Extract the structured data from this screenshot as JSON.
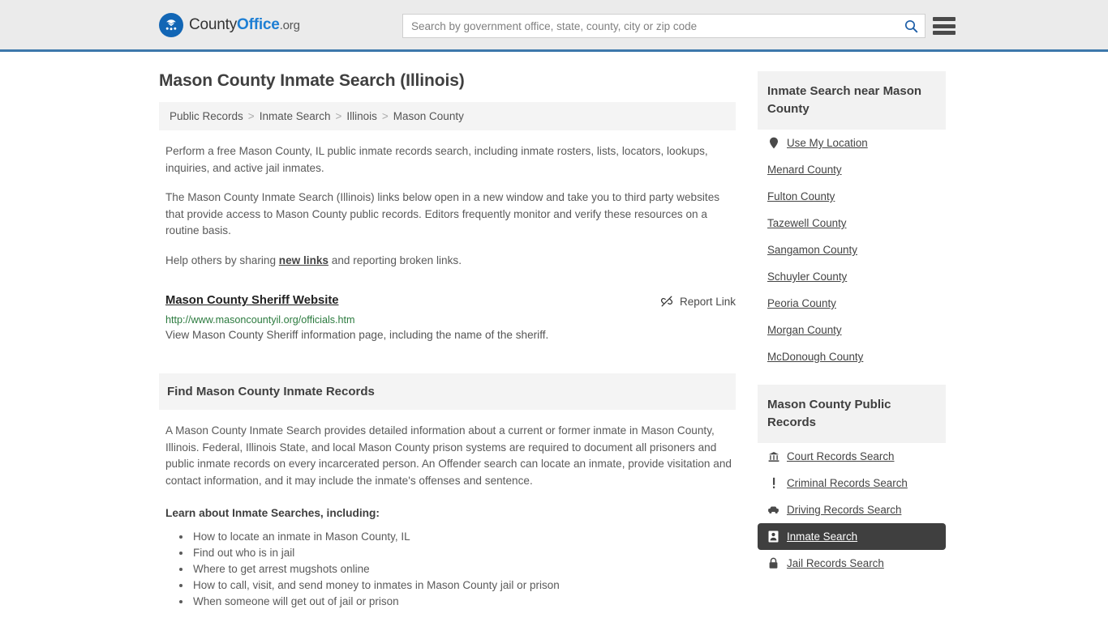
{
  "header": {
    "logo": {
      "icon": "eagle-seal-icon",
      "part1": "County",
      "part2": "Office",
      "part3": ".org"
    },
    "search": {
      "placeholder": "Search by government office, state, county, city or zip code",
      "value": "",
      "icon": "search-icon"
    },
    "menu_icon": "hamburger-menu-icon",
    "accent_color": "#3d78ab",
    "background_color": "#ebebeb"
  },
  "main": {
    "title": "Mason County Inmate Search (Illinois)",
    "breadcrumb": [
      {
        "label": "Public Records"
      },
      {
        "label": "Inmate Search"
      },
      {
        "label": "Illinois"
      },
      {
        "label": "Mason County"
      }
    ],
    "breadcrumb_separator": ">",
    "paragraph1": "Perform a free Mason County, IL public inmate records search, including inmate rosters, lists, locators, lookups, inquiries, and active jail inmates.",
    "paragraph2": "The Mason County Inmate Search (Illinois) links below open in a new window and take you to third party websites that provide access to Mason County public records. Editors frequently monitor and verify these resources on a routine basis.",
    "paragraph3_pre": "Help others by sharing ",
    "paragraph3_link": "new links",
    "paragraph3_post": " and reporting broken links.",
    "resource": {
      "title": "Mason County Sheriff Website",
      "url": "http://www.masoncountyil.org/officials.htm",
      "description": "View Mason County Sheriff information page, including the name of the sheriff.",
      "report_label": "Report Link",
      "report_icon": "broken-link-icon"
    },
    "section_title": "Find Mason County Inmate Records",
    "section_body": "A Mason County Inmate Search provides detailed information about a current or former inmate in Mason County, Illinois. Federal, Illinois State, and local Mason County prison systems are required to document all prisoners and public inmate records on every incarcerated person. An Offender search can locate an inmate, provide visitation and contact information, and it may include the inmate's offenses and sentence.",
    "list_heading": "Learn about Inmate Searches, including:",
    "list_items": [
      "How to locate an inmate in Mason County, IL",
      "Find out who is in jail",
      "Where to get arrest mugshots online",
      "How to call, visit, and send money to inmates in Mason County jail or prison",
      "When someone will get out of jail or prison"
    ]
  },
  "sidebar": {
    "nearby": {
      "title": "Inmate Search near Mason County",
      "items": [
        {
          "label": "Use My Location",
          "icon": "map-pin-icon"
        },
        {
          "label": "Menard County",
          "icon": ""
        },
        {
          "label": "Fulton County",
          "icon": ""
        },
        {
          "label": "Tazewell County",
          "icon": ""
        },
        {
          "label": "Sangamon County",
          "icon": ""
        },
        {
          "label": "Schuyler County",
          "icon": ""
        },
        {
          "label": "Peoria County",
          "icon": ""
        },
        {
          "label": "Morgan County",
          "icon": ""
        },
        {
          "label": "McDonough County",
          "icon": ""
        }
      ]
    },
    "public_records": {
      "title": "Mason County Public Records",
      "items": [
        {
          "label": "Court Records Search",
          "icon": "courthouse-icon",
          "active": false
        },
        {
          "label": "Criminal Records Search",
          "icon": "exclamation-icon",
          "active": false
        },
        {
          "label": "Driving Records Search",
          "icon": "car-icon",
          "active": false
        },
        {
          "label": "Inmate Search",
          "icon": "id-card-icon",
          "active": true
        },
        {
          "label": "Jail Records Search",
          "icon": "lock-icon",
          "active": false
        }
      ]
    }
  }
}
